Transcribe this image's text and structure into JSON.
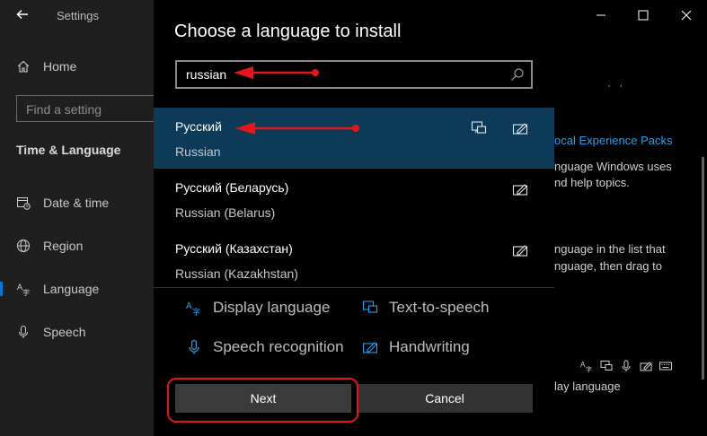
{
  "window": {
    "title": "Settings",
    "controls": {
      "minimize": "minimize-icon",
      "maximize": "maximize-icon",
      "close": "close-icon"
    }
  },
  "sidebar": {
    "home_label": "Home",
    "search_placeholder": "Find a setting",
    "section_title": "Time & Language",
    "items": [
      {
        "label": "Date & time",
        "icon": "calendar-clock-icon"
      },
      {
        "label": "Region",
        "icon": "globe-icon"
      },
      {
        "label": "Language",
        "icon": "language-icon",
        "active": true
      },
      {
        "label": "Speech",
        "icon": "microphone-icon"
      }
    ]
  },
  "background_content": {
    "dots": "· ·",
    "link": "ocal Experience Packs",
    "texts": [
      "nguage Windows uses",
      "nd help topics.",
      "nguage in the list that",
      "nguage, then drag to",
      "lay language"
    ]
  },
  "dialog": {
    "title": "Choose a language to install",
    "search_value": "russian",
    "languages": [
      {
        "native": "Русский",
        "english": "Russian",
        "selected": true,
        "features": [
          "text-to-speech-icon",
          "handwriting-icon"
        ]
      },
      {
        "native": "Русский (Беларусь)",
        "english": "Russian (Belarus)",
        "selected": false,
        "features": [
          "handwriting-icon"
        ]
      },
      {
        "native": "Русский (Казахстан)",
        "english": "Russian (Kazakhstan)",
        "selected": false,
        "features": [
          "handwriting-icon"
        ]
      }
    ],
    "features_legend": {
      "display_language": "Display language",
      "text_to_speech": "Text-to-speech",
      "speech_recognition": "Speech recognition",
      "handwriting": "Handwriting"
    },
    "buttons": {
      "next": "Next",
      "cancel": "Cancel"
    }
  },
  "colors": {
    "accent": "#0078d7",
    "selected_row": "#0c3a57",
    "feature_icon": "#2aa0e8",
    "annotation": "#e3171b"
  }
}
